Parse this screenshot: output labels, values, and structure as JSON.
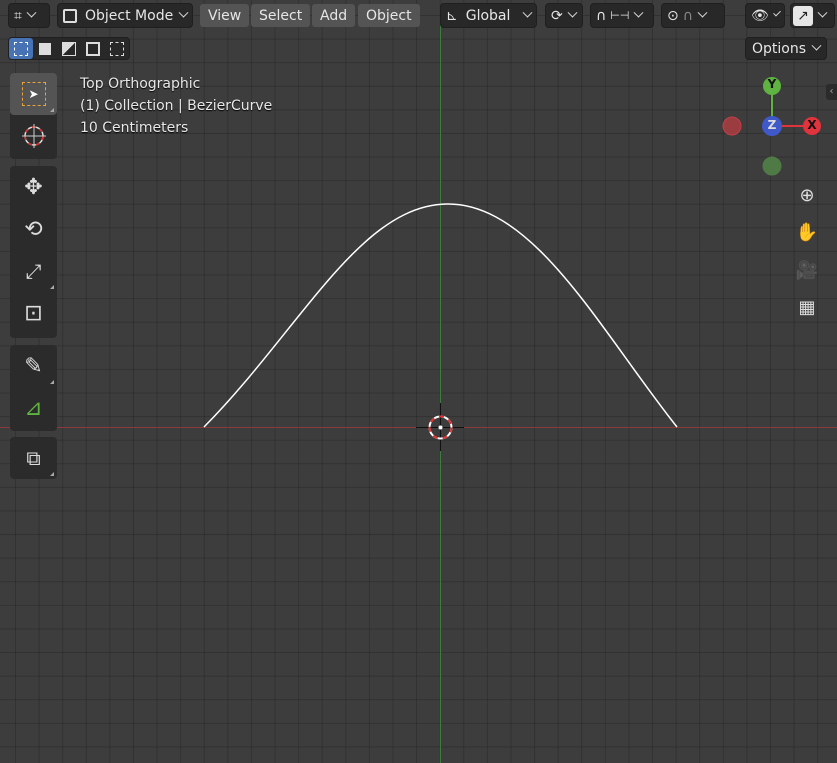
{
  "header": {
    "editor_type_icon": "grid-editor-icon",
    "mode": "Object Mode",
    "menus": [
      "View",
      "Select",
      "Add",
      "Object"
    ],
    "transform_orientation": "Global"
  },
  "options_label": "Options",
  "overlay_text": {
    "view_name": "Top Orthographic",
    "collection": "(1) Collection | BezierCurve",
    "scale": "10 Centimeters"
  },
  "gizmo": {
    "y_label": "Y",
    "z_label": "Z",
    "x_label": "X",
    "colors": {
      "x": "#e0333d",
      "y": "#5fb340",
      "z": "#3f59c9"
    }
  },
  "tools": [
    "select-box-tool",
    "cursor-tool",
    "move-tool",
    "rotate-tool",
    "scale-tool",
    "transform-tool",
    "annotate-tool",
    "measure-tool",
    "add-cube-tool"
  ],
  "nav_icons": [
    "zoom-icon",
    "hand-pan-icon",
    "camera-icon",
    "grid-perspective-icon"
  ],
  "colors": {
    "background": "#3d3d3d",
    "grid_line": "#353535",
    "x_axis": "#8a3a3a",
    "y_axis": "#3f7a3f",
    "curve": "#ffffff",
    "active_blue": "#4772b3"
  }
}
